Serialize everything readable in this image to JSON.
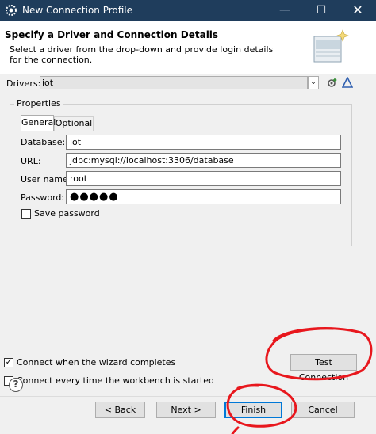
{
  "window": {
    "title": "New Connection Profile",
    "minimize_glyph": "—",
    "maximize_glyph": "☐",
    "close_glyph": "✕"
  },
  "header": {
    "title": "Specify a Driver and Connection Details",
    "description": "Select a driver from the drop-down and provide login details for the connection.",
    "banner_icon": "wizard-banner-icon"
  },
  "drivers": {
    "label": "Drivers:",
    "selected": "iot",
    "dropdown_glyph": "⌄",
    "new_icon": "new-driver-icon",
    "edit_icon": "edit-driver-icon"
  },
  "properties": {
    "legend": "Properties",
    "tabs": [
      {
        "label": "General",
        "selected": true
      },
      {
        "label": "Optional",
        "selected": false
      }
    ],
    "fields": {
      "database": {
        "label": "Database:",
        "value": "iot"
      },
      "url": {
        "label": "URL:",
        "value": "jdbc:mysql://localhost:3306/database"
      },
      "username": {
        "label": "User name:",
        "value": "root"
      },
      "password": {
        "label": "Password:",
        "value": "●●●●●"
      }
    },
    "save_password": {
      "label": "Save password",
      "checked": false
    }
  },
  "options": {
    "connect_on_finish": {
      "label": "Connect when the wizard completes",
      "checked": true
    },
    "connect_on_startup": {
      "label": "Connect every time the workbench is started",
      "checked": false
    }
  },
  "buttons": {
    "test_connection": "Test Connection",
    "back": "< Back",
    "next": "Next >",
    "finish": "Finish",
    "cancel": "Cancel",
    "help_glyph": "?"
  },
  "colors": {
    "titlebar": "#1f3d5c",
    "annotation": "#e8171d",
    "default_button_border": "#0078d7"
  }
}
